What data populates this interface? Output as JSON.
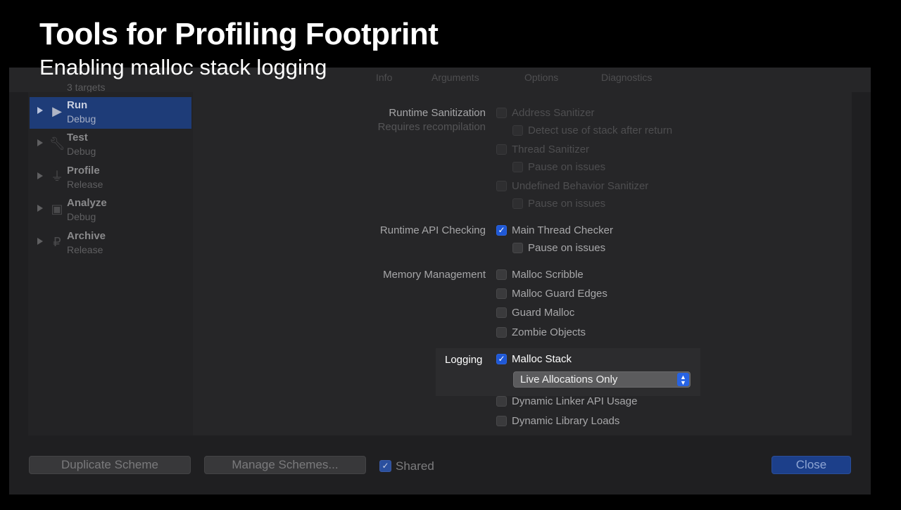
{
  "slide": {
    "title": "Tools for Profiling Footprint",
    "subtitle": "Enabling malloc stack logging"
  },
  "header_ghost": {
    "targets": "3 targets",
    "tabs": [
      "Info",
      "Arguments",
      "Options",
      "Diagnostics"
    ]
  },
  "sidebar": {
    "items": [
      {
        "title": "Run",
        "sub": "Debug",
        "icon": "play-icon",
        "selected": true
      },
      {
        "title": "Test",
        "sub": "Debug",
        "icon": "wrench-icon",
        "selected": false
      },
      {
        "title": "Profile",
        "sub": "Release",
        "icon": "instruments-icon",
        "selected": false
      },
      {
        "title": "Analyze",
        "sub": "Debug",
        "icon": "analyze-icon",
        "selected": false
      },
      {
        "title": "Archive",
        "sub": "Release",
        "icon": "archive-icon",
        "selected": false
      }
    ]
  },
  "diagnostics": {
    "runtime_sanitization": {
      "label": "Runtime Sanitization",
      "sub": "Requires recompilation",
      "address_sanitizer": "Address Sanitizer",
      "detect_stack": "Detect use of stack after return",
      "thread_sanitizer": "Thread Sanitizer",
      "pause_1": "Pause on issues",
      "ub_sanitizer": "Undefined Behavior Sanitizer",
      "pause_2": "Pause on issues"
    },
    "runtime_api": {
      "label": "Runtime API Checking",
      "main_thread_checker": "Main Thread Checker",
      "pause": "Pause on issues"
    },
    "memory": {
      "label": "Memory Management",
      "malloc_scribble": "Malloc Scribble",
      "malloc_guard_edges": "Malloc Guard Edges",
      "guard_malloc": "Guard Malloc",
      "zombie_objects": "Zombie Objects"
    },
    "logging": {
      "label": "Logging",
      "malloc_stack": "Malloc Stack",
      "mode_selected": "Live Allocations Only",
      "dynamic_linker": "Dynamic Linker API Usage",
      "dynamic_library": "Dynamic Library Loads"
    }
  },
  "footer": {
    "duplicate": "Duplicate Scheme",
    "manage": "Manage Schemes...",
    "shared": "Shared",
    "close": "Close"
  },
  "colors": {
    "accent": "#1f58d6",
    "selection": "#1e3c78",
    "background": "#000000"
  }
}
